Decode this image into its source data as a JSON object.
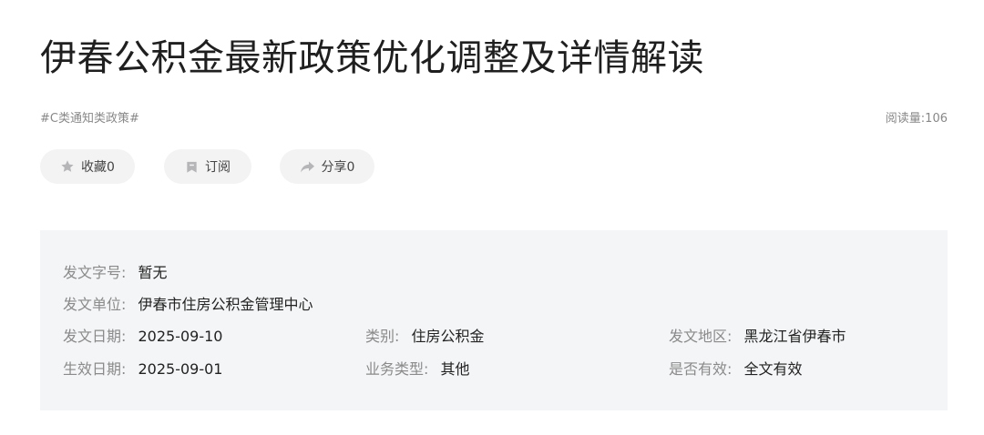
{
  "article": {
    "title": "伊春公积金最新政策优化调整及详情解读",
    "tag": "#C类通知类政策#",
    "read_count": "阅读量:106"
  },
  "actions": {
    "favorite": {
      "label": "收藏0",
      "icon": "star-icon"
    },
    "subscribe": {
      "label": "订阅",
      "icon": "bookmark-icon"
    },
    "share": {
      "label": "分享0",
      "icon": "share-arrow-icon"
    }
  },
  "info": {
    "doc_number": {
      "label": "发文字号:",
      "value": "暂无"
    },
    "issuer": {
      "label": "发文单位:",
      "value": "伊春市住房公积金管理中心"
    },
    "issue_date": {
      "label": "发文日期:",
      "value": "2025-09-10"
    },
    "category": {
      "label": "类别:",
      "value": "住房公积金"
    },
    "region": {
      "label": "发文地区:",
      "value": "黑龙江省伊春市"
    },
    "effective_date": {
      "label": "生效日期:",
      "value": "2025-09-01"
    },
    "business_type": {
      "label": "业务类型:",
      "value": "其他"
    },
    "validity": {
      "label": "是否有效:",
      "value": "全文有效"
    }
  },
  "colors": {
    "background": "#ffffff",
    "pill_background": "#f3f3f4",
    "info_background": "#f4f5f7",
    "label_text": "#8a8a8a",
    "muted_text": "#888888",
    "icon": "#b5b5b8"
  }
}
